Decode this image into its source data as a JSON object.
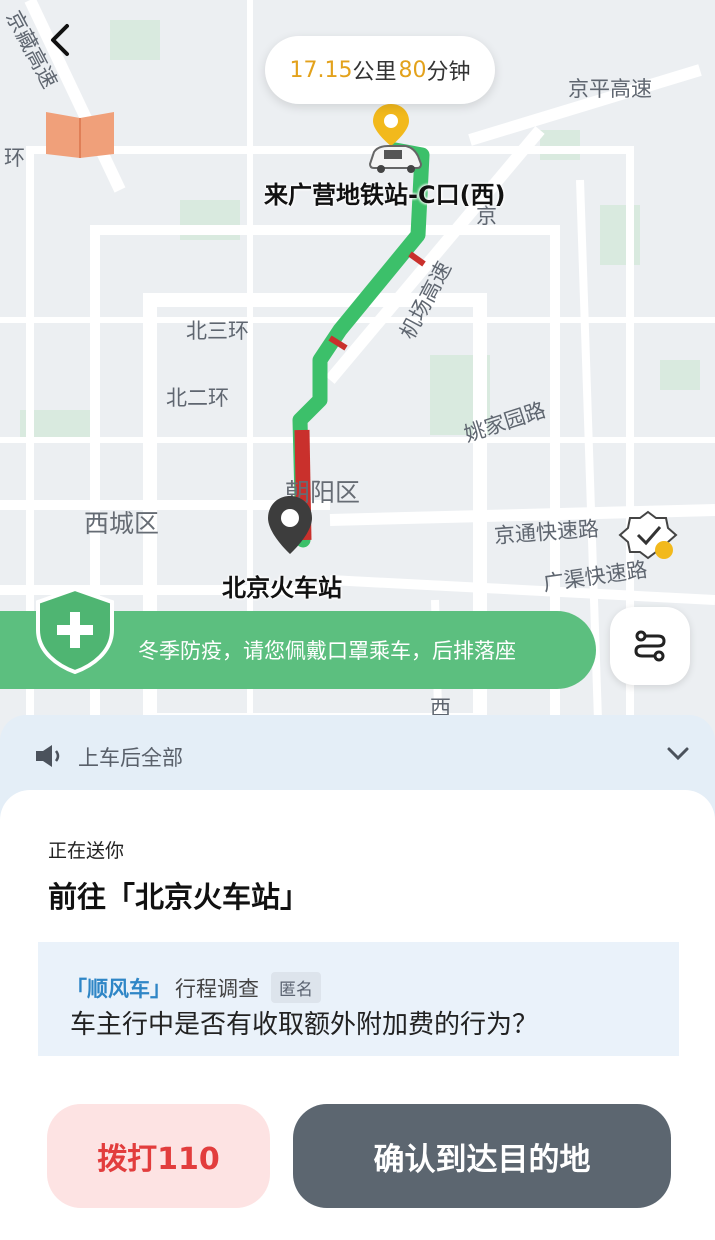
{
  "map": {
    "labels": {
      "jingzang": "京藏高速",
      "huan": "环",
      "jingping": "京平高速",
      "jing": "京",
      "airport": "机场高速",
      "north3": "北三环",
      "north2": "北二环",
      "yaojia": "姚家园路",
      "chaoyang": "朝阳区",
      "xicheng": "西城区",
      "jingtong": "京通快速路",
      "guangqu": "广渠快速路",
      "xi": "西"
    },
    "origin": "来广营地铁站-C口(西)",
    "destination": "北京火车站"
  },
  "trip": {
    "distance_value": "17.15",
    "distance_unit": "公里",
    "time_value": "80",
    "time_unit": "分钟"
  },
  "banner": {
    "text": "冬季防疫，请您佩戴口罩乘车，后排落座"
  },
  "notice": {
    "label": "上车后全部"
  },
  "card": {
    "status": "正在送你",
    "destination": "前往「北京火车站」",
    "survey": {
      "brand": "「顺风车」",
      "kind": "行程调查",
      "anon": "匿名",
      "question": "车主行中是否有收取额外附加费的行为？"
    },
    "call_button": "拨打110",
    "confirm_button": "确认到达目的地"
  },
  "colors": {
    "route_green": "#3cc06a",
    "route_red": "#c9302c",
    "banner_green": "#5cbf7f",
    "accent_orange": "#e3a21c",
    "call_red": "#e23d3d"
  },
  "icons": [
    "back-arrow-icon",
    "map-book-icon",
    "origin-pin-icon",
    "car-icon",
    "destination-pin-icon",
    "shield-plus-icon",
    "route-icon",
    "speaker-icon",
    "chevron-down-icon",
    "badge-check-icon"
  ]
}
